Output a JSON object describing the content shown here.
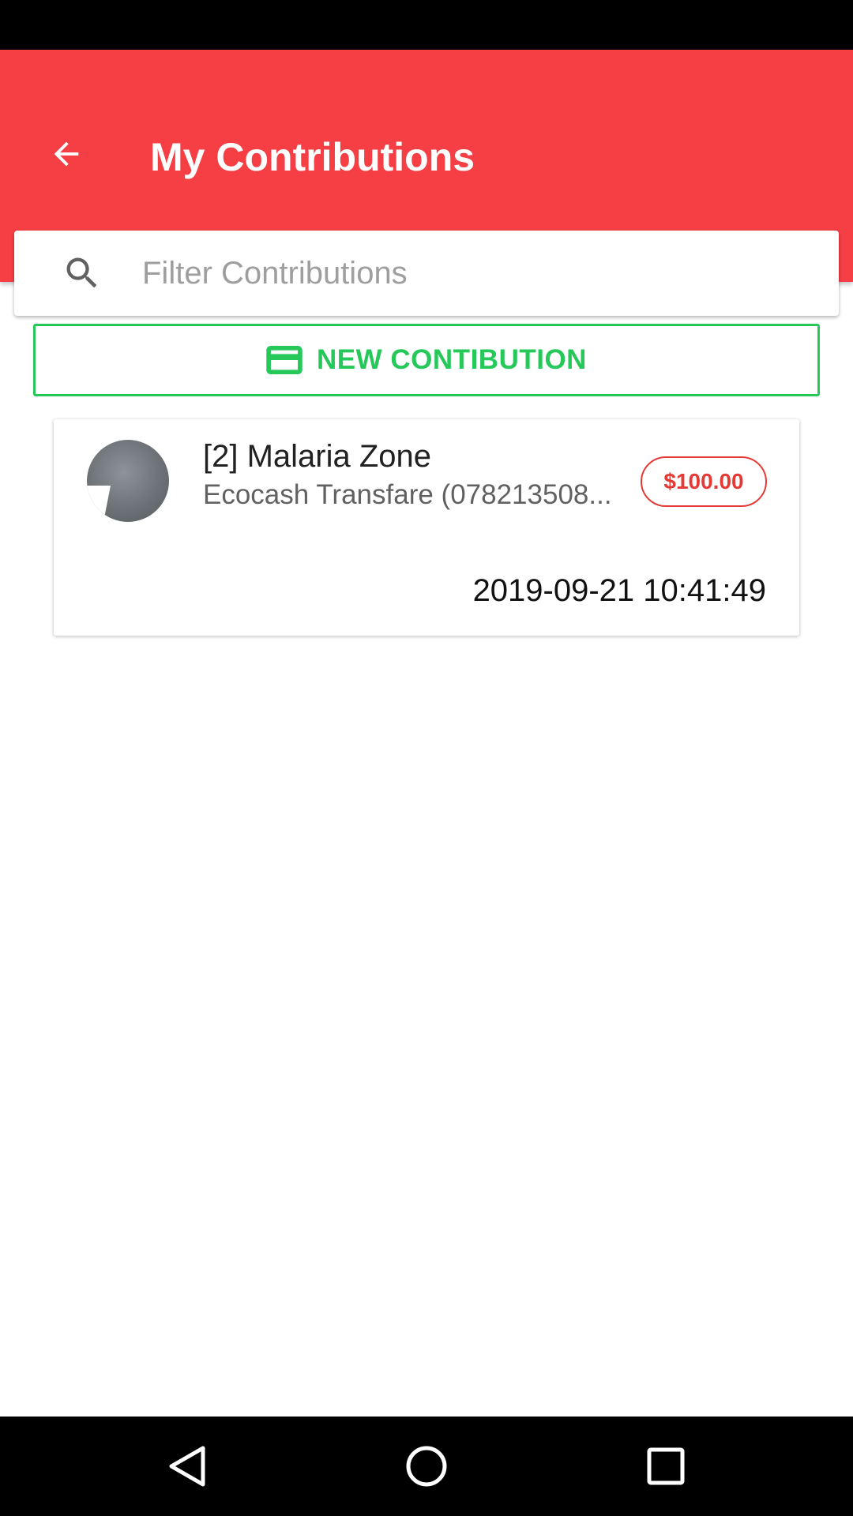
{
  "app_bar": {
    "title": "My Contributions",
    "background_color": "#f53f44",
    "back_icon": "arrow-back-icon"
  },
  "search": {
    "placeholder": "Filter Contributions",
    "value": "",
    "icon": "search-icon"
  },
  "new_button": {
    "label": "NEW CONTIBUTION",
    "icon": "credit-card-icon",
    "color": "#27c85a"
  },
  "contributions": [
    {
      "title": "[2] Malaria Zone",
      "subtitle": "Ecocash Transfare (078213508...",
      "amount": "$100.00",
      "date": "2019-09-21 10:41:49",
      "amount_color": "#e53935"
    }
  ],
  "nav_bar": {
    "buttons": [
      "back-triangle-icon",
      "home-circle-icon",
      "recents-square-icon"
    ]
  }
}
